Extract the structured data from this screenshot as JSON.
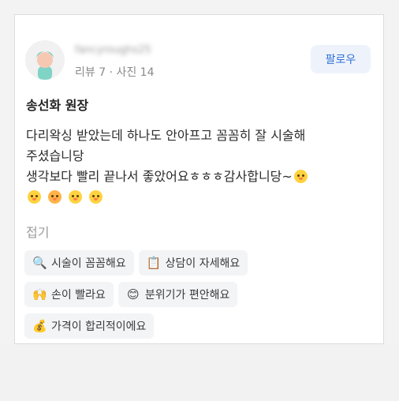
{
  "profile": {
    "username": "fancyroughs25",
    "stats": "리뷰 7 · 사진 14",
    "follow_label": "팔로우"
  },
  "review": {
    "title": "송선화 원장",
    "line1": "다리왁싱 받았는데 하나도 안아프고 꼼꼼히 잘 시술해",
    "line2": "주셨습니당",
    "line3": "생각보다 빨리 끝나서 좋았어요ㅎㅎㅎ감사합니당~",
    "fold_label": "접기"
  },
  "tags": [
    {
      "icon": "magnifier-icon",
      "glyph": "🔍",
      "label": "시술이 꼼꼼해요"
    },
    {
      "icon": "clipboard-icon",
      "glyph": "📋",
      "label": "상담이 자세해요"
    },
    {
      "icon": "hands-icon",
      "glyph": "🙌",
      "label": "손이 빨라요"
    },
    {
      "icon": "smiling-face-icon",
      "glyph": "😊",
      "label": "분위기가 편안해요"
    },
    {
      "icon": "coin-hand-icon",
      "glyph": "💰",
      "label": "가격이 합리적이에요"
    }
  ],
  "colors": {
    "accent": "#2f6fd8",
    "follow_bg": "#eef3fb",
    "tag_bg": "#f3f4f6"
  }
}
